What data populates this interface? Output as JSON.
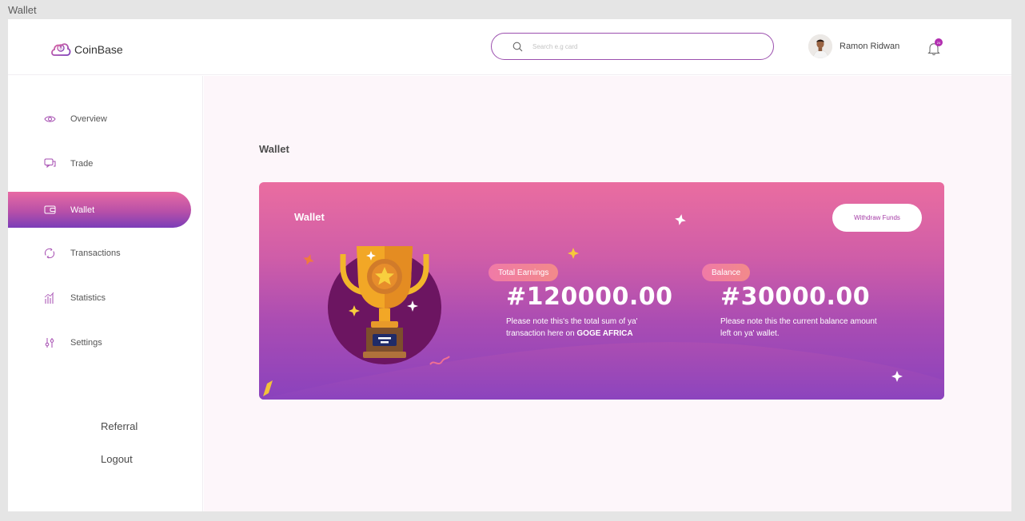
{
  "frame_label": "Wallet",
  "header": {
    "brand": "CoinBase",
    "search_placeholder": "Search e.g card",
    "user_name": "Ramon Ridwan",
    "notification_count": "24"
  },
  "sidebar": {
    "items": [
      {
        "label": "Overview",
        "icon": "eye-icon"
      },
      {
        "label": "Trade",
        "icon": "chat-icon"
      },
      {
        "label": "Wallet",
        "icon": "wallet-icon",
        "active": true
      },
      {
        "label": "Transactions",
        "icon": "refresh-icon"
      },
      {
        "label": "Statistics",
        "icon": "bar-chart-icon"
      },
      {
        "label": "Settings",
        "icon": "sliders-icon"
      }
    ],
    "referral_label": "Referral",
    "logout_label": "Logout"
  },
  "main": {
    "page_title": "Wallet",
    "card": {
      "title": "Wallet",
      "withdraw_label": "Withdraw Funds",
      "earnings": {
        "pill": "Total Earnings",
        "amount": "#120000.00",
        "note_text": "Please note this's the total sum of ya' transaction here on ",
        "note_bold": "GOGE AFRICA"
      },
      "balance": {
        "pill": "Balance",
        "amount": "#30000.00",
        "note_text": "Please note this the current balance amount left on ya' wallet."
      }
    }
  },
  "colors": {
    "accent": "#9b4fae",
    "card_top": "#ea6da0",
    "card_bottom": "#8a42bd",
    "page_bg": "#fdf6fa"
  }
}
